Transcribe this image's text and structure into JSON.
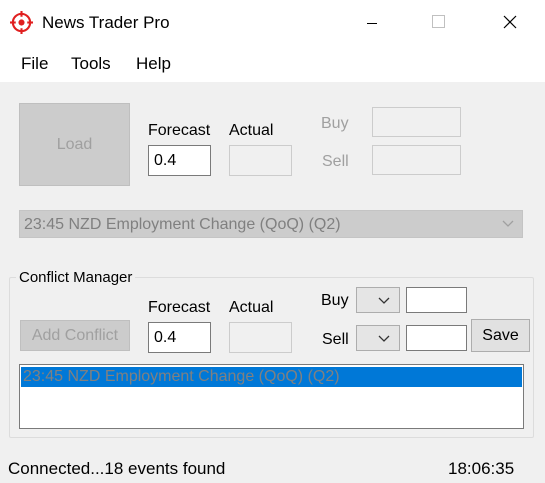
{
  "window": {
    "title": "News Trader Pro",
    "controls": [
      "minimize-icon",
      "maximize-icon",
      "close-icon"
    ]
  },
  "menu": {
    "items": [
      "File",
      "Tools",
      "Help"
    ]
  },
  "top_panel": {
    "load_label": "Load",
    "forecast_label": "Forecast",
    "actual_label": "Actual",
    "forecast_value": "0.4",
    "actual_value": "",
    "buy_label": "Buy",
    "sell_label": "Sell",
    "buy_value": "",
    "sell_value": ""
  },
  "event_combo": {
    "selected": "23:45 NZD Employment Change (QoQ) (Q2)"
  },
  "conflict_manager": {
    "title": "Conflict Manager",
    "add_conflict_label": "Add Conflict",
    "forecast_label": "Forecast",
    "actual_label": "Actual",
    "forecast_value": "0.4",
    "actual_value": "",
    "buy_label": "Buy",
    "sell_label": "Sell",
    "buy_value": "",
    "sell_value": "",
    "save_label": "Save",
    "list_items": [
      "23:45 NZD Employment Change (QoQ) (Q2)"
    ]
  },
  "status": {
    "text": "Connected...18 events found",
    "time": "18:06:35"
  },
  "colors": {
    "selection": "#0078d7",
    "window_bg": "#f0f0f0",
    "icon_red": "#e02020"
  }
}
